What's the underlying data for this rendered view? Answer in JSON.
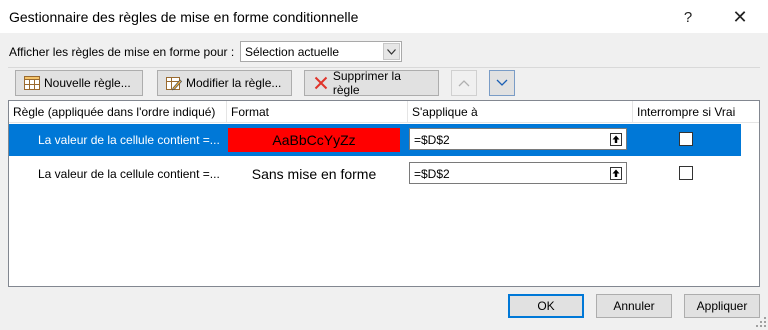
{
  "window": {
    "title": "Gestionnaire des règles de mise en forme conditionnelle",
    "help_glyph": "?",
    "close_glyph": "✕"
  },
  "show_rules": {
    "label": "Afficher les règles de mise en forme pour :",
    "selected": "Sélection actuelle"
  },
  "toolbar": {
    "new_rule": "Nouvelle règle...",
    "edit_rule": "Modifier la règle...",
    "delete_rule": "Supprimer la règle"
  },
  "columns": {
    "rule": "Règle (appliquée dans l'ordre indiqué)",
    "format": "Format",
    "applies_to": "S'applique à",
    "stop_if_true": "Interrompre si Vrai"
  },
  "rules": [
    {
      "name": "La valeur de la cellule contient =...",
      "format_preview": "AaBbCcYyZz",
      "format_fill": "#ff0000",
      "applies_to": "=$D$2",
      "stop_if_true": false,
      "selected": true
    },
    {
      "name": "La valeur de la cellule contient =...",
      "format_preview": "Sans mise en forme",
      "applies_to": "=$D$2",
      "stop_if_true": false,
      "selected": false
    }
  ],
  "footer": {
    "ok": "OK",
    "cancel": "Annuler",
    "apply": "Appliquer"
  },
  "colors": {
    "selection": "#0078d7",
    "accent": "#0078d7"
  }
}
